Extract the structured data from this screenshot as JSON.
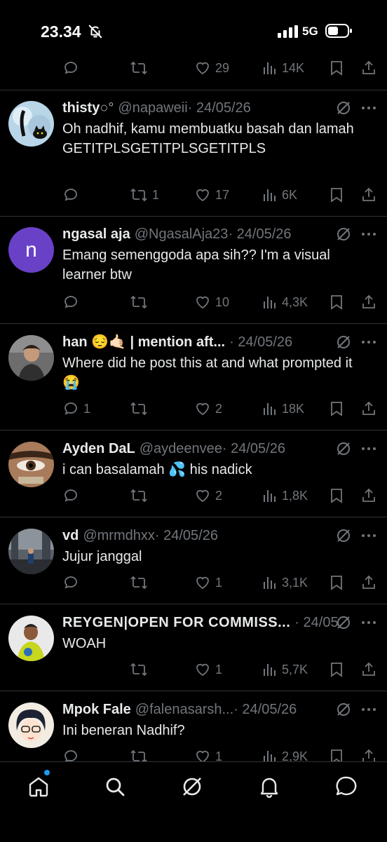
{
  "status_bar": {
    "time": "23.34",
    "network": "5G"
  },
  "top_actions": {
    "likes": "29",
    "views": "14K"
  },
  "tweets": [
    {
      "name": "thisty",
      "handle": "@napaweii",
      "date": "· 24/05/26",
      "text": "Oh nadhif, kamu membuatku basah dan lamah GETITPLSGETITPLSGETITPLS",
      "replies": "",
      "retweets": "1",
      "likes": "17",
      "views": "6K",
      "avatar": "cat-avatar"
    },
    {
      "name": "ngasal aja",
      "handle": "@NgasalAja23",
      "date": "· 24/05/26",
      "text": "Emang semenggoda apa sih?? I'm a visual learner btw",
      "replies": "",
      "retweets": "",
      "likes": "10",
      "views": "4,3K",
      "avatar_letter": "n",
      "avatar_color": "#6941c6"
    },
    {
      "name": "han 😔🤙🏻 | mention aft...",
      "handle": "",
      "date": "· 24/05/26",
      "text": "Where did he post this at and what prompted it 😭",
      "replies": "1",
      "retweets": "",
      "likes": "2",
      "views": "18K",
      "avatar": "photo-avatar"
    },
    {
      "name": "Ayden DaL",
      "handle": "@aydeenvee",
      "date": "· 24/05/26",
      "text": "i can basalamah 💦 his nadick",
      "replies": "",
      "retweets": "",
      "likes": "2",
      "views": "1,8K",
      "avatar": "eye-avatar"
    },
    {
      "name": "vd",
      "handle": "@mrmdhxx",
      "date": "· 24/05/26",
      "text": "Jujur janggal",
      "replies": "",
      "retweets": "",
      "likes": "1",
      "views": "3,1K",
      "avatar": "street-avatar"
    },
    {
      "name": "REYGEN|OPEN FOR COMMISS...",
      "handle": "",
      "date": "· 24/05/26",
      "text": "WOAH",
      "replies": "",
      "retweets": "",
      "likes": "1",
      "views": "5,7K",
      "avatar": "person-avatar"
    },
    {
      "name": "Mpok Fale",
      "handle": "@falenasarsh...",
      "date": "· 24/05/26",
      "text": "Ini beneran Nadhif?",
      "replies": "",
      "retweets": "",
      "likes": "1",
      "views": "2,9K",
      "avatar": "anime-avatar"
    }
  ],
  "colors": {
    "background": "#000000",
    "text": "#e7e9ea",
    "muted": "#71767b",
    "divider": "#2f3336",
    "accent": "#1d9bf0"
  },
  "icons": [
    "reply-icon",
    "retweet-icon",
    "like-icon",
    "views-icon",
    "bookmark-icon",
    "share-icon",
    "grok-icon",
    "more-icon",
    "home-icon",
    "search-icon",
    "grok-tab-icon",
    "notifications-icon",
    "messages-icon"
  ]
}
